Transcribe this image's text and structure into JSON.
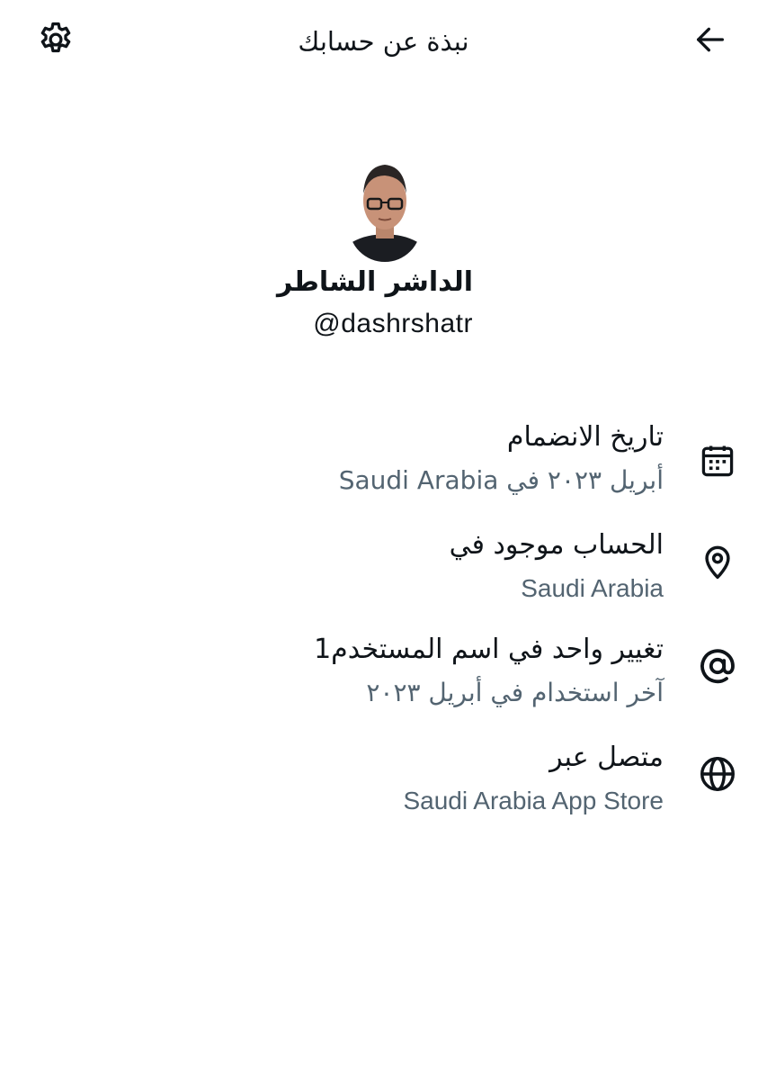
{
  "header": {
    "title": "نبذة عن حسابك",
    "back_icon": "arrow-left-icon",
    "settings_icon": "gear-icon"
  },
  "profile": {
    "display_name": "الداشر الشاطر",
    "handle": "@dashrshatr"
  },
  "info": [
    {
      "icon": "calendar-icon",
      "title": "تاريخ الانضمام",
      "subtitle": "أبريل ٢٠٢٣ في Saudi Arabia"
    },
    {
      "icon": "location-pin-icon",
      "title": "الحساب موجود في",
      "subtitle": "Saudi Arabia"
    },
    {
      "icon": "at-sign-icon",
      "title": "تغيير واحد في اسم المستخدم1",
      "subtitle": "آخر استخدام في أبريل ٢٠٢٣"
    },
    {
      "icon": "globe-icon",
      "title": "متصل عبر",
      "subtitle": "Saudi Arabia App Store"
    }
  ],
  "colors": {
    "text_primary": "#0f1419",
    "text_secondary": "#536471",
    "background": "#ffffff"
  }
}
